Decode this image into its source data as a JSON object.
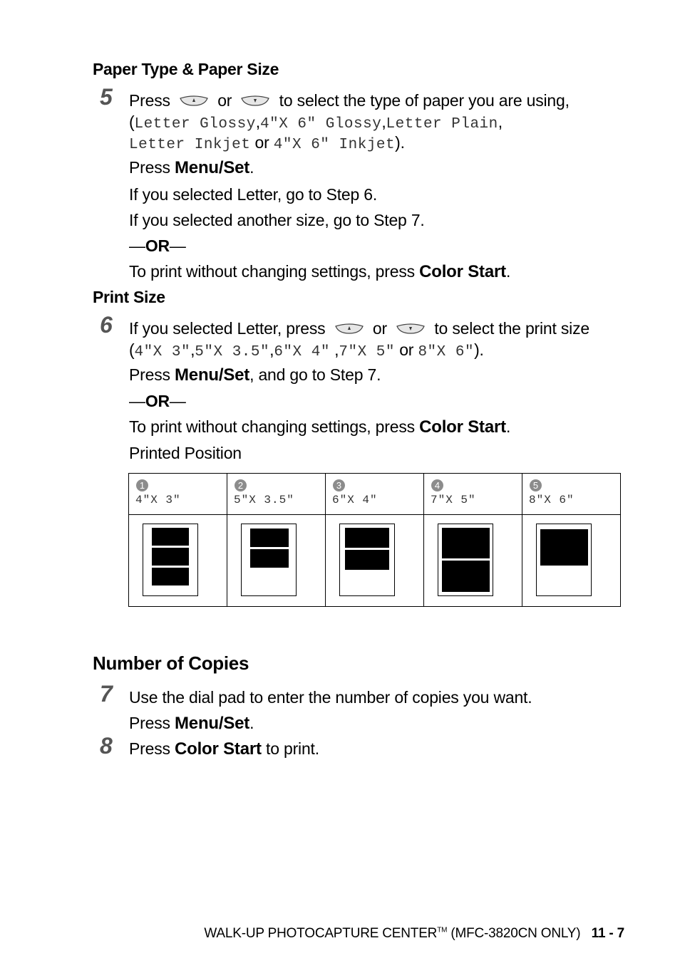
{
  "sections": {
    "paper": {
      "title": "Paper Type & Paper Size"
    },
    "print_size": {
      "title": "Print Size"
    },
    "copies": {
      "title": "Number of Copies"
    }
  },
  "buttons": {
    "up": "up-arrow-button",
    "down": "down-arrow-button"
  },
  "step5": {
    "number": "5",
    "l1_a": "Press",
    "l1_or": "or",
    "l1_b": "to select the type of paper you are using,",
    "paren_open": "(",
    "opt1": "Letter Glossy",
    "comma": ",",
    "opt2": "4\"X 6\" Glossy",
    "opt3": "Letter Plain",
    "opt4": "Letter Inkjet",
    "or2": "or",
    "opt5": "4\"X 6\" Inkjet",
    "paren_close": ").",
    "press": "Press",
    "menuset": "Menu/Set",
    "dot": ".",
    "if_letter": "If you selected Letter, go to Step 6.",
    "if_other": "If you selected another size, go to Step 7.",
    "or_dash_l": "—",
    "or_word": "OR",
    "or_dash_r": "—",
    "noset": "To print without changing settings, press",
    "colorstart": "Color Start"
  },
  "step6": {
    "number": "6",
    "l1_a": "If you selected Letter, press",
    "l1_or": "or",
    "l1_b": "to select the print size",
    "paren_open": "(",
    "s1": "4\"X 3\"",
    "s2": "5\"X 3.5\"",
    "s3": "6\"X 4\"",
    "s4": "7\"X 5\"",
    "or2": "or",
    "s5": "8\"X 6\"",
    "paren_close": ").",
    "press": "Press",
    "menuset": "Menu/Set",
    "then": ", and go to Step 7.",
    "or_word": "OR",
    "noset": "To print without changing settings, press",
    "colorstart": "Color Start",
    "printed_position": "Printed Position"
  },
  "position_table": [
    {
      "badge": "1",
      "size": "4\"X 3\"",
      "photos": 3
    },
    {
      "badge": "2",
      "size": "5\"X 3.5\"",
      "photos": 2
    },
    {
      "badge": "3",
      "size": "6\"X 4\"",
      "photos": 2
    },
    {
      "badge": "4",
      "size": "7\"X 5\"",
      "photos": 2
    },
    {
      "badge": "5",
      "size": "8\"X 6\"",
      "photos": 1
    }
  ],
  "step7": {
    "number": "7",
    "text": "Use the dial pad to enter the number of copies you want.",
    "press": "Press",
    "menuset": "Menu/Set",
    "dot": "."
  },
  "step8": {
    "number": "8",
    "press": "Press",
    "colorstart": "Color Start",
    "rest": "to print."
  },
  "footer": {
    "title": "WALK-UP PHOTOCAPTURE CENTER",
    "tm": "TM",
    "model": "(MFC-3820CN ONLY)",
    "page": "11 - 7"
  }
}
